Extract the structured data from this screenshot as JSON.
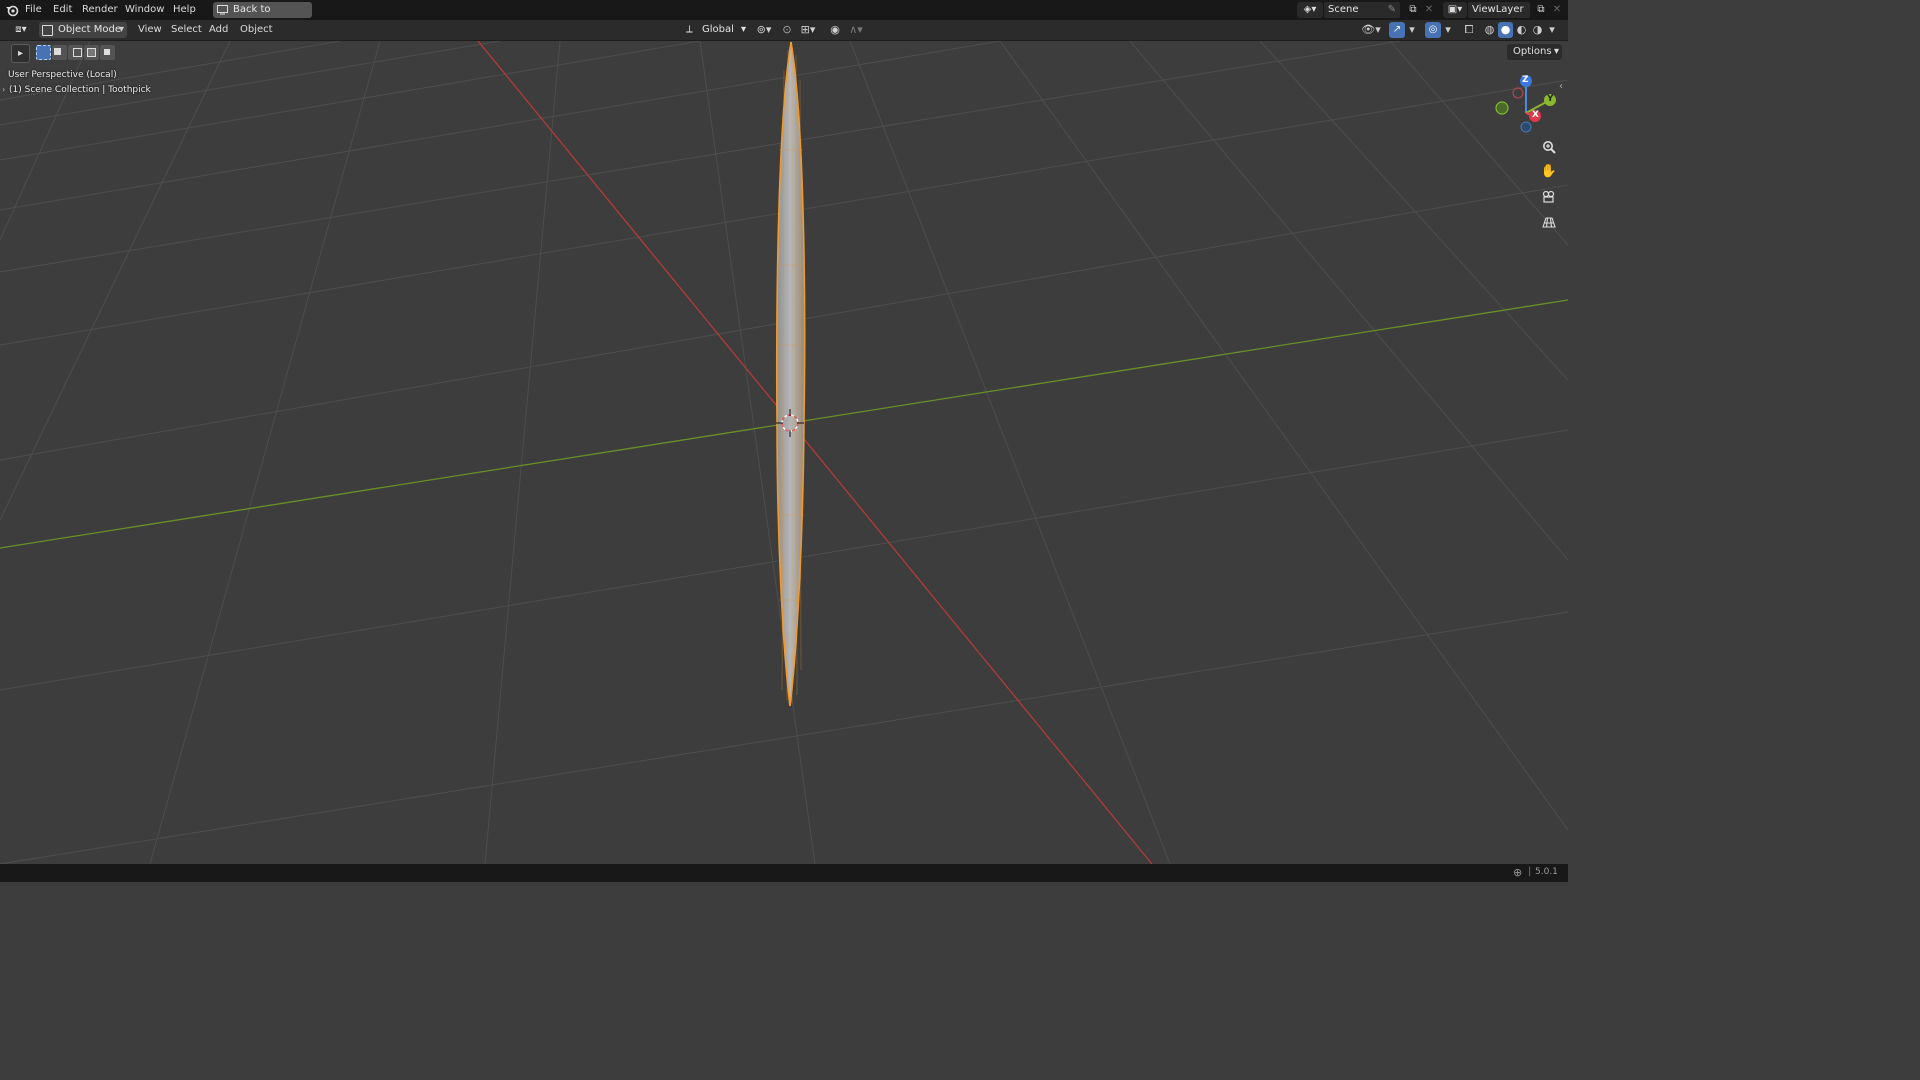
{
  "topbar": {
    "menus": [
      "File",
      "Edit",
      "Render",
      "Window",
      "Help"
    ],
    "back_button": "Back to Previous",
    "scene": "Scene",
    "view_layer": "ViewLayer"
  },
  "header": {
    "mode": "Object Mode",
    "menus": [
      "View",
      "Select",
      "Add",
      "Object"
    ],
    "transform_orientation": "Global",
    "options": "Options"
  },
  "viewport": {
    "perspective": "User Perspective (Local)",
    "collection": "(1) Scene Collection | Toothpick"
  },
  "gizmo": {
    "z": "Z",
    "y": "Y",
    "x": "X"
  },
  "status": {
    "version": "5.0.1"
  },
  "colors": {
    "x_axis": "#c83a3a",
    "y_axis": "#6f9a2a",
    "selected_outline": "#f39a2b",
    "active_tool": "#4772b3"
  },
  "icons": {
    "blender_logo": "blender-logo-icon",
    "zoom": "zoom-icon",
    "pan": "hand-icon",
    "camera": "camera-icon",
    "ortho": "grid-icon"
  }
}
